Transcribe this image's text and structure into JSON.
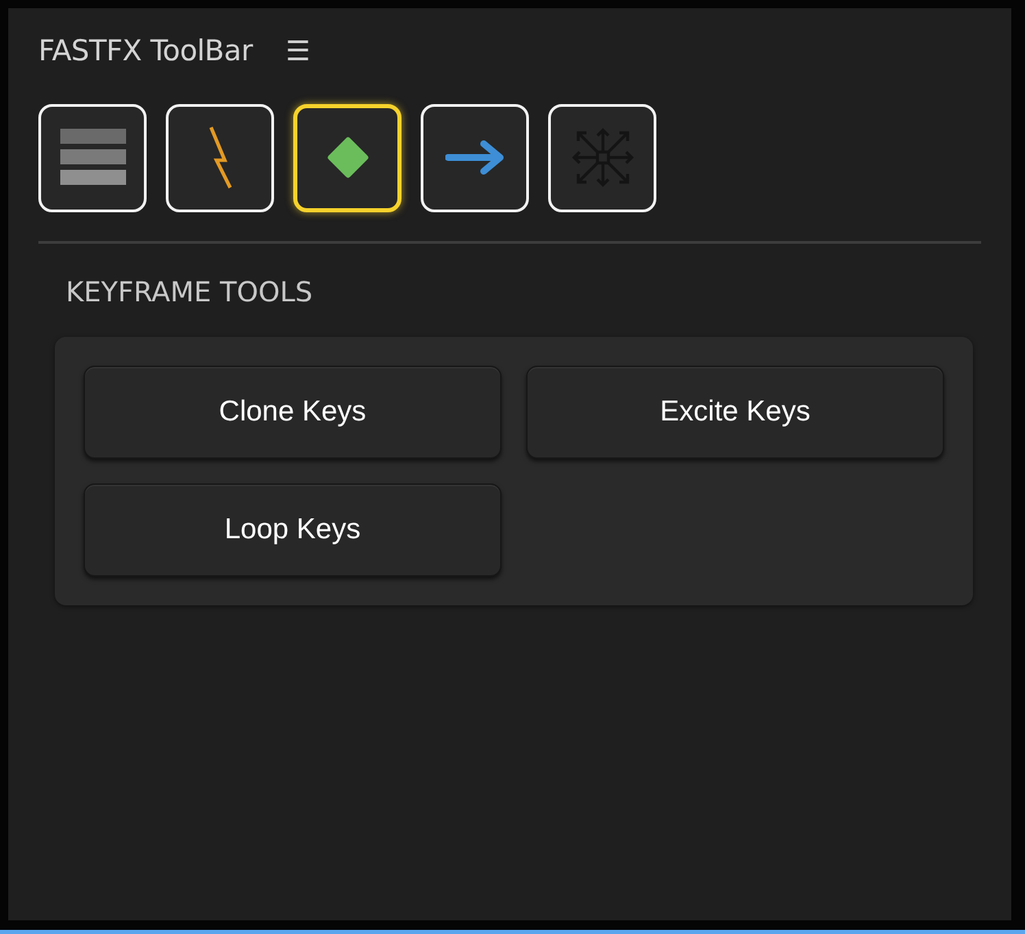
{
  "panel": {
    "title": "FASTFX ToolBar",
    "menu_icon": "☰"
  },
  "tool_buttons": [
    {
      "kind": "bars",
      "selected": false
    },
    {
      "kind": "bolt",
      "selected": false
    },
    {
      "kind": "diamond",
      "selected": true
    },
    {
      "kind": "arrow",
      "selected": false
    },
    {
      "kind": "move",
      "selected": false
    }
  ],
  "section": {
    "title": "KEYFRAME TOOLS",
    "actions": [
      {
        "label": "Clone Keys"
      },
      {
        "label": "Excite Keys"
      },
      {
        "label": "Loop Keys"
      }
    ]
  }
}
